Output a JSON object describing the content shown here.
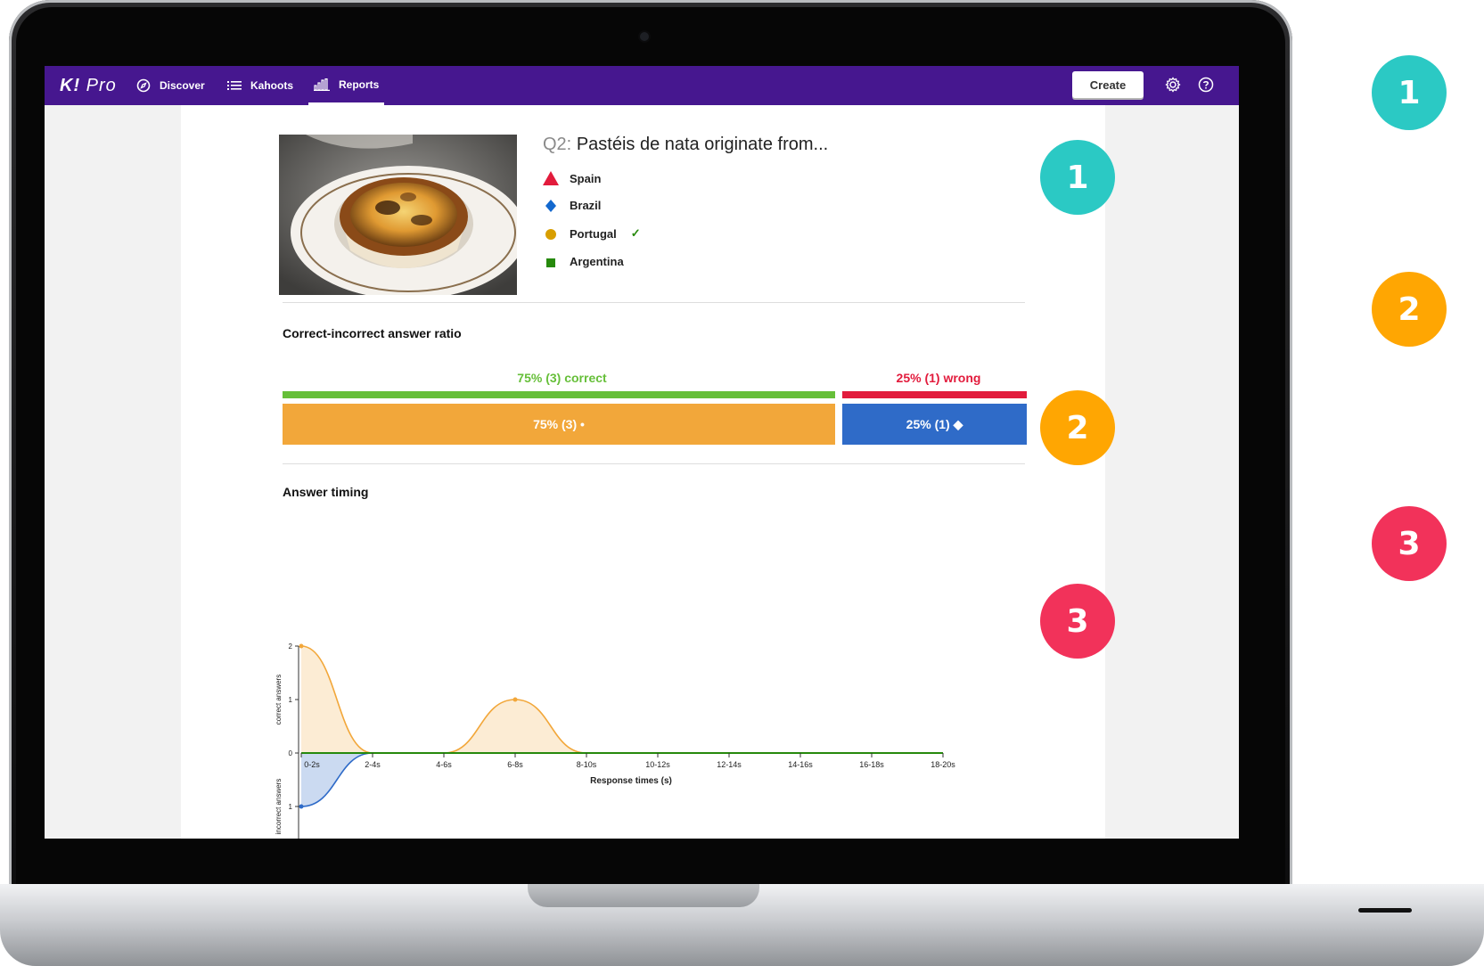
{
  "nav": {
    "logo": "K!",
    "logo_suffix": "Pro",
    "items": [
      {
        "label": "Discover",
        "icon": "compass-icon"
      },
      {
        "label": "Kahoots",
        "icon": "list-icon"
      },
      {
        "label": "Reports",
        "icon": "bar-chart-icon",
        "active": true
      }
    ],
    "create_label": "Create",
    "settings_icon": "gear-icon",
    "help_icon": "help-icon",
    "bg_color": "#46178f"
  },
  "question": {
    "number": "Q2:",
    "text": "Pastéis de nata originate from...",
    "image_alt": "pastel-de-nata-photo",
    "answers": [
      {
        "label": "Spain",
        "shape": "triangle",
        "color": "#e21b3c",
        "correct": false
      },
      {
        "label": "Brazil",
        "shape": "diamond",
        "color": "#1368ce",
        "correct": false
      },
      {
        "label": "Portugal",
        "shape": "circle",
        "color": "#d89e00",
        "correct": true,
        "check": "✓"
      },
      {
        "label": "Argentina",
        "shape": "square",
        "color": "#26890c",
        "correct": false
      }
    ]
  },
  "ratio": {
    "title": "Correct-incorrect answer ratio",
    "correct_label": "75% (3) correct",
    "wrong_label": "25% (1) wrong",
    "correct_fraction": 0.75,
    "wrong_fraction": 0.25,
    "correct_bar_label": "75% (3) •",
    "wrong_bar_label": "25% (1) ◆",
    "correct_color": "#66bf39",
    "wrong_color": "#e21b3c",
    "correct_answer_color": "#f2a73a",
    "wrong_answer_color": "#2f6bc8"
  },
  "timing": {
    "title": "Answer timing",
    "xlabel": "Response times (s)",
    "ylabel_top": "correct answers",
    "ylabel_bottom": "incorrect answers",
    "ticks_top": [
      "0",
      "1",
      "2"
    ],
    "ticks_bottom": [
      "1",
      "0"
    ]
  },
  "chart_data": {
    "type": "area",
    "categories": [
      "0-2s",
      "2-4s",
      "4-6s",
      "6-8s",
      "8-10s",
      "10-12s",
      "12-14s",
      "14-16s",
      "16-18s",
      "18-20s"
    ],
    "series": [
      {
        "name": "correct answers",
        "values": [
          2,
          0,
          0,
          1,
          0,
          0,
          0,
          0,
          0,
          0
        ],
        "color": "#f2a73a"
      },
      {
        "name": "incorrect answers",
        "values": [
          1,
          0,
          0,
          0,
          0,
          0,
          0,
          0,
          0,
          0
        ],
        "color": "#2f6bc8"
      }
    ],
    "xlabel": "Response times (s)",
    "ylim_correct": [
      0,
      2
    ],
    "ylim_incorrect": [
      0,
      1
    ]
  },
  "markers": [
    {
      "num": "1",
      "color": "#2bc9c4"
    },
    {
      "num": "2",
      "color": "#ffa602"
    },
    {
      "num": "3",
      "color": "#f2325a"
    }
  ]
}
